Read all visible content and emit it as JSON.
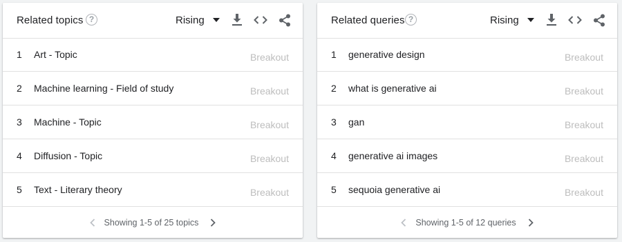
{
  "left_panel": {
    "title": "Related topics",
    "help_icon": "?",
    "filter_selected": "Rising",
    "rows": [
      {
        "rank": "1",
        "label": "Art - Topic",
        "value": "Breakout"
      },
      {
        "rank": "2",
        "label": "Machine learning - Field of study",
        "value": "Breakout"
      },
      {
        "rank": "3",
        "label": "Machine - Topic",
        "value": "Breakout"
      },
      {
        "rank": "4",
        "label": "Diffusion - Topic",
        "value": "Breakout"
      },
      {
        "rank": "5",
        "label": "Text - Literary theory",
        "value": "Breakout"
      }
    ],
    "footer_text": "Showing 1-5 of 25 topics"
  },
  "right_panel": {
    "title": "Related queries",
    "help_icon": "?",
    "filter_selected": "Rising",
    "rows": [
      {
        "rank": "1",
        "label": "generative design",
        "value": "Breakout"
      },
      {
        "rank": "2",
        "label": "what is generative ai",
        "value": "Breakout"
      },
      {
        "rank": "3",
        "label": "gan",
        "value": "Breakout"
      },
      {
        "rank": "4",
        "label": "generative ai images",
        "value": "Breakout"
      },
      {
        "rank": "5",
        "label": "sequoia generative ai",
        "value": "Breakout"
      }
    ],
    "footer_text": "Showing 1-5 of 12 queries"
  },
  "icons": {
    "download": "download-icon",
    "embed": "embed-code-icon",
    "share": "share-icon",
    "prev": "chevron-left-icon",
    "next": "chevron-right-icon"
  },
  "colors": {
    "background": "#f1f3f4",
    "breakout": "#bdbdbd",
    "divider": "#e0e0e0",
    "pager_disabled": "#bdc1c6",
    "pager_active": "#5f6368"
  }
}
